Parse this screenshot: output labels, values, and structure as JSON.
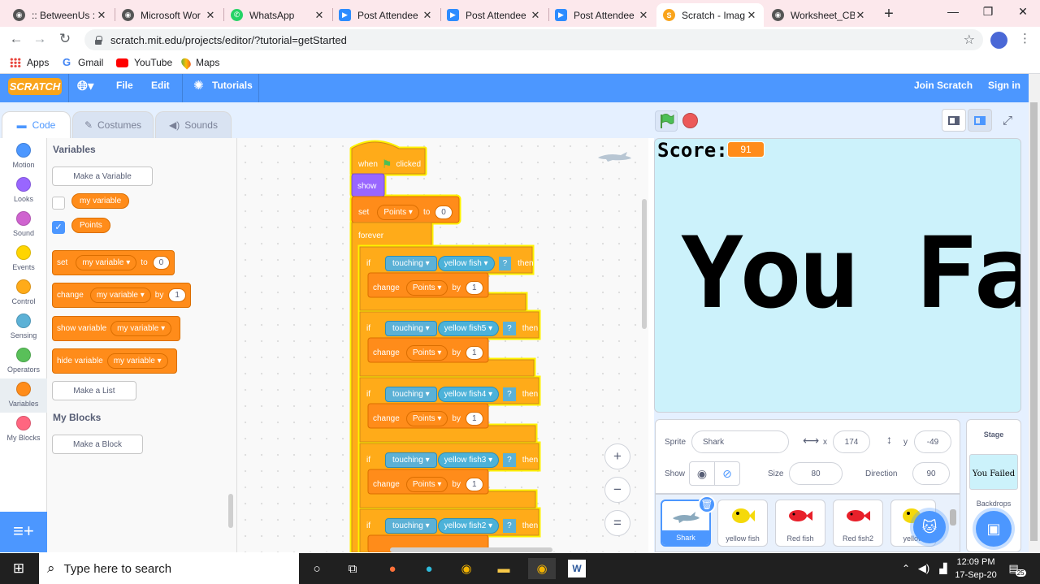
{
  "browser": {
    "tabs": [
      {
        "title": ":: BetweenUs ::",
        "color": "#555"
      },
      {
        "title": "Microsoft Wor",
        "color": "#555"
      },
      {
        "title": "WhatsApp",
        "color": "#25d366"
      },
      {
        "title": "Post Attendee",
        "color": "#2d8cff"
      },
      {
        "title": "Post Attendee",
        "color": "#2d8cff"
      },
      {
        "title": "Post Attendee",
        "color": "#2d8cff"
      },
      {
        "title": "Scratch - Imag",
        "color": "#f9a41b"
      },
      {
        "title": "Worksheet_CB",
        "color": "#555"
      }
    ],
    "url": "scratch.mit.edu/projects/editor/?tutorial=getStarted",
    "bookmarks": [
      "Apps",
      "Gmail",
      "YouTube",
      "Maps"
    ]
  },
  "menu": {
    "logo": "SCRATCH",
    "file": "File",
    "edit": "Edit",
    "tutorials": "Tutorials",
    "join": "Join Scratch",
    "signin": "Sign in"
  },
  "editor_tabs": [
    "Code",
    "Costumes",
    "Sounds"
  ],
  "categories": [
    {
      "label": "Motion",
      "color": "#4c97ff"
    },
    {
      "label": "Looks",
      "color": "#9966ff"
    },
    {
      "label": "Sound",
      "color": "#cf63cf"
    },
    {
      "label": "Events",
      "color": "#ffd500"
    },
    {
      "label": "Control",
      "color": "#ffab19"
    },
    {
      "label": "Sensing",
      "color": "#5cb1d6"
    },
    {
      "label": "Operators",
      "color": "#59c059"
    },
    {
      "label": "Variables",
      "color": "#ff8c1a"
    },
    {
      "label": "My Blocks",
      "color": "#ff6680"
    }
  ],
  "palette": {
    "variables_title": "Variables",
    "make_variable": "Make a Variable",
    "var1": "my variable",
    "var2": "Points",
    "set_block": {
      "verb": "set",
      "var": "my variable",
      "to": "to",
      "val": "0"
    },
    "change_block": {
      "verb": "change",
      "var": "my variable",
      "by": "by",
      "val": "1"
    },
    "show_block": {
      "verb": "show variable",
      "var": "my variable"
    },
    "hide_block": {
      "verb": "hide variable",
      "var": "my variable"
    },
    "make_list": "Make a List",
    "myblocks_title": "My Blocks",
    "make_block": "Make a Block"
  },
  "script": {
    "hat": {
      "when": "when",
      "clicked": "clicked"
    },
    "show": "show",
    "set": {
      "verb": "set",
      "var": "Points",
      "to": "to",
      "val": "0"
    },
    "forever": "forever",
    "ifs": [
      {
        "if": "if",
        "touching": "touching",
        "target": "yellow fish",
        "q": "?",
        "then": "then",
        "change": "change",
        "var": "Points",
        "by": "by",
        "val": "1"
      },
      {
        "if": "if",
        "touching": "touching",
        "target": "yellow fish5",
        "q": "?",
        "then": "then",
        "change": "change",
        "var": "Points",
        "by": "by",
        "val": "1"
      },
      {
        "if": "if",
        "touching": "touching",
        "target": "yellow fish4",
        "q": "?",
        "then": "then",
        "change": "change",
        "var": "Points",
        "by": "by",
        "val": "1"
      },
      {
        "if": "if",
        "touching": "touching",
        "target": "yellow fish3",
        "q": "?",
        "then": "then",
        "change": "change",
        "var": "Points",
        "by": "by",
        "val": "1"
      },
      {
        "if": "if",
        "touching": "touching",
        "target": "yellow fish2",
        "q": "?",
        "then": "then"
      }
    ]
  },
  "zoom": {
    "in": "+",
    "out": "−",
    "reset": "="
  },
  "stage": {
    "score_label": "Score:",
    "score_value": "91",
    "message": "You Failed"
  },
  "sprite_info": {
    "sprite_label": "Sprite",
    "sprite_name": "Shark",
    "x_label": "x",
    "x": "174",
    "y_label": "y",
    "y": "-49",
    "show_label": "Show",
    "size_label": "Size",
    "size": "80",
    "direction_label": "Direction",
    "direction": "90"
  },
  "sprites": [
    {
      "name": "Shark",
      "color": "#8aa9bd"
    },
    {
      "name": "yellow fish",
      "color": "#f5d90a"
    },
    {
      "name": "Red fish",
      "color": "#e8202a"
    },
    {
      "name": "Red fish2",
      "color": "#e8202a"
    },
    {
      "name": "yellow",
      "color": "#f5d90a"
    }
  ],
  "stage_panel": {
    "title": "Stage",
    "thumb_text": "You Failed",
    "backdrops": "Backdrops"
  },
  "taskbar": {
    "search_placeholder": "Type here to search",
    "time": "12:09 PM",
    "date": "17-Sep-20",
    "notifications": "25"
  }
}
